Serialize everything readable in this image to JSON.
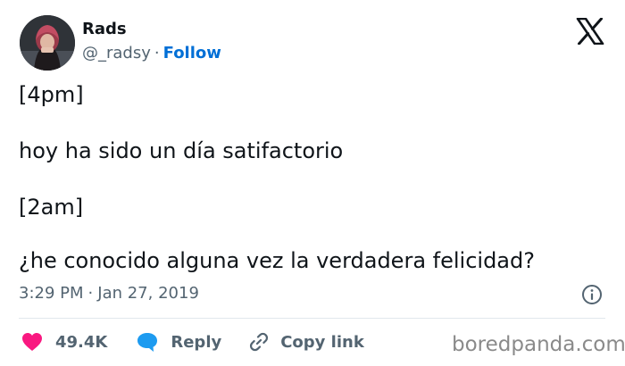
{
  "author": {
    "name": "Rads",
    "handle": "@_radsy",
    "separator": "·",
    "follow_label": "Follow",
    "avatar": "profile-photo"
  },
  "platform_icon": "x-logo-icon",
  "tweet": {
    "lines": [
      "[4pm]",
      "hoy ha sido un día satifactorio",
      "[2am]",
      "¿he conocido alguna vez la verdadera felicidad?"
    ]
  },
  "meta": {
    "time": "3:29 PM",
    "separator": "·",
    "date": "Jan 27, 2019",
    "info_icon": "info-icon"
  },
  "actions": {
    "like": {
      "icon": "heart-icon",
      "count": "49.4K",
      "color": "#f91880"
    },
    "reply": {
      "icon": "speech-bubble-icon",
      "label": "Reply",
      "color": "#1d9bf0"
    },
    "copy": {
      "icon": "link-icon",
      "label": "Copy link"
    }
  },
  "watermark": "boredpanda.com",
  "colors": {
    "follow": "#006fd6",
    "secondary_text": "#536471",
    "primary_text": "#0f1419"
  }
}
